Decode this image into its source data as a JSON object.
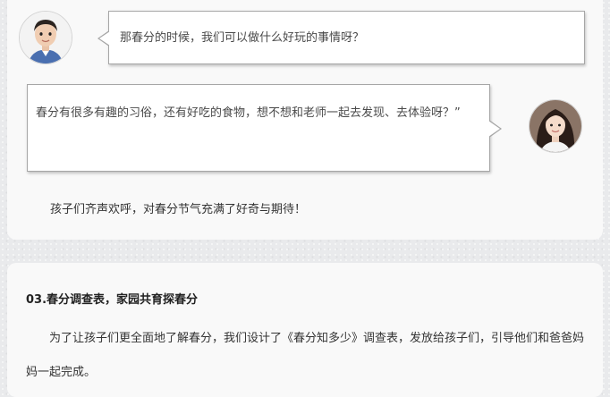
{
  "conversation": {
    "child_message": "那春分的时候，我们可以做什么好玩的事情呀？",
    "teacher_message": "春分有很多有趣的习俗，还有好吃的食物，想不想和老师一起去发现、去体验呀？”"
  },
  "article": {
    "cheer_paragraph": "孩子们齐声欢呼，对春分节气充满了好奇与期待！",
    "section_title": "03.春分调查表，家园共育探春分",
    "survey_paragraph": "为了让孩子们更全面地了解春分，我们设计了《春分知多少》调查表，发放给孩子们，引导他们和爸爸妈妈一起完成。"
  },
  "avatars": {
    "child": "child-avatar-photo",
    "teacher": "teacher-avatar-photo"
  },
  "colors": {
    "page_background": "#e9eaec",
    "card_background": "#f9f9f9",
    "bubble_border": "#a6a6a6",
    "text": "#333333"
  }
}
